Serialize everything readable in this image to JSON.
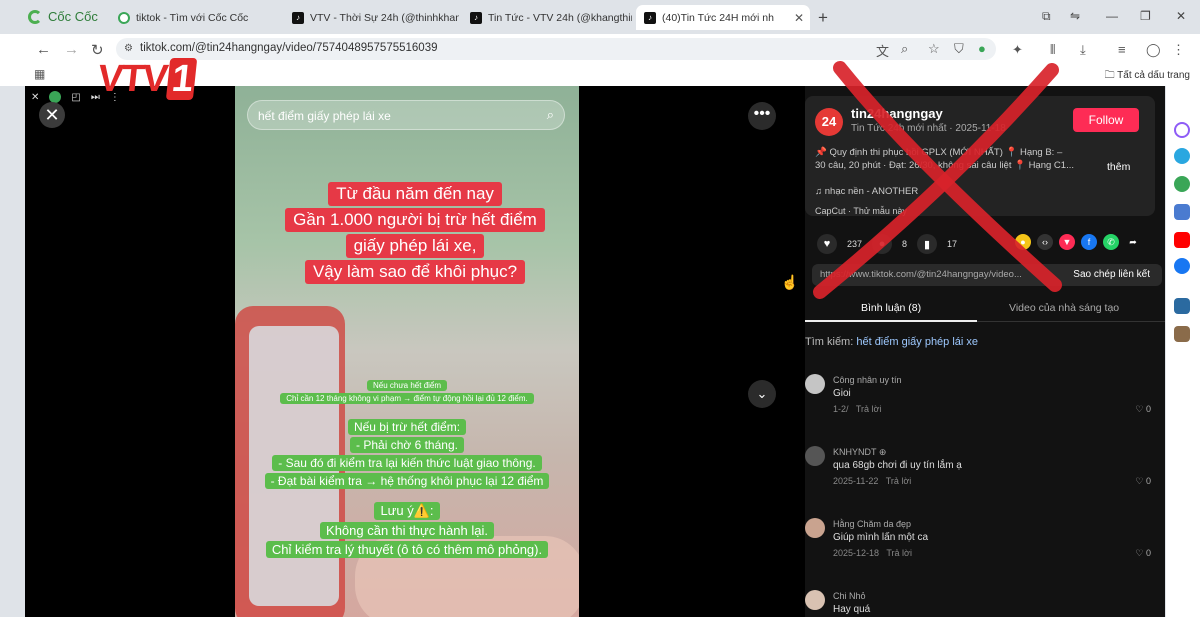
{
  "browser": {
    "brand": "Cốc Cốc",
    "tabs": [
      {
        "label": "tiktok - Tìm với Cốc Cốc"
      },
      {
        "label": "VTV - Thời Sự 24h (@thinhkhang"
      },
      {
        "label": "Tin Tức - VTV 24h (@khangthinh"
      },
      {
        "label": "(40)Tin Tức 24H mới nh"
      }
    ],
    "url": "tiktok.com/@tin24hangngay/video/7574048957575516039",
    "bookmarks_label": "Tất cả dấu trang"
  },
  "overlay": {
    "logo": "VTV",
    "logo_num": "1"
  },
  "video": {
    "search_text": "hết điểm giấy phép lái xe",
    "headline": [
      "Từ đầu năm đến nay",
      "Gần 1.000 người bị trừ hết điểm",
      "giấy phép lái xe,",
      "Vậy làm sao để khôi phục?"
    ],
    "note_small": [
      "Nếu chưa hết điểm",
      "Chỉ cần 12 tháng không vi phạm → điểm tự động hồi lại đủ 12 điểm."
    ],
    "note_mid": [
      "Nếu bị trừ hết điểm:",
      "- Phải chờ 6 tháng.",
      "- Sau đó đi kiểm tra lại kiến thức luật giao thông.",
      "- Đạt bài kiểm tra → hệ thống khôi phục lại 12 điểm"
    ],
    "note_end": [
      "Lưu ý⚠️:",
      "Không cần thi thực hành lại.",
      "Chỉ kiểm tra lý thuyết (ô tô có thêm mô phỏng)."
    ]
  },
  "panel": {
    "avatar": "24",
    "username": "tin24hangngay",
    "subline": "Tin Tức 24h mới nhất · 2025-11-18",
    "follow": "Follow",
    "desc1": "📌 Quy định thi phục hồi GPLX (MỚI NHẤT) 📍 Hạng B: –",
    "desc2": "30 câu, 20 phút · Đạt: 26/30, không sai câu liệt 📍 Hạng C1...",
    "more": "thêm",
    "music": "♫  nhạc nền - ANOTHER",
    "capcut": "CapCut · Thử mẫu này",
    "likes": "237",
    "comments": "8",
    "saves": "17",
    "copy_url": "https://www.tiktok.com/@tin24hangngay/video...",
    "copy_btn": "Sao chép liên kết",
    "tab_comments": "Bình luận (8)",
    "tab_creator": "Video của nhà sáng tạo",
    "search_prefix": "Tìm kiếm:",
    "search_term": "hết điểm giấy phép lái xe",
    "comments_list": [
      {
        "name": "Công nhân uy tín",
        "text": "Gioi",
        "date": "1-2/",
        "reply": "Trả lời",
        "likes": "0"
      },
      {
        "name": "KNHYNDT ⊕",
        "text": "qua 68gb chơi đi uy tín lắm ạ",
        "date": "2025-11-22",
        "reply": "Trả lời",
        "likes": "0"
      },
      {
        "name": "Hằng Chăm da đẹp",
        "text": "Giúp mình lấn một ca",
        "date": "2025-12-18",
        "reply": "Trả lời",
        "likes": "0"
      },
      {
        "name": "Chi Nhỏ",
        "text": "Hay quá",
        "date": "",
        "reply": "",
        "likes": ""
      }
    ]
  },
  "colors": {
    "accent": "#fe2c55",
    "x_mark": "#d8232a",
    "green_caption": "#5cbd4c",
    "red_caption": "#e63946"
  }
}
